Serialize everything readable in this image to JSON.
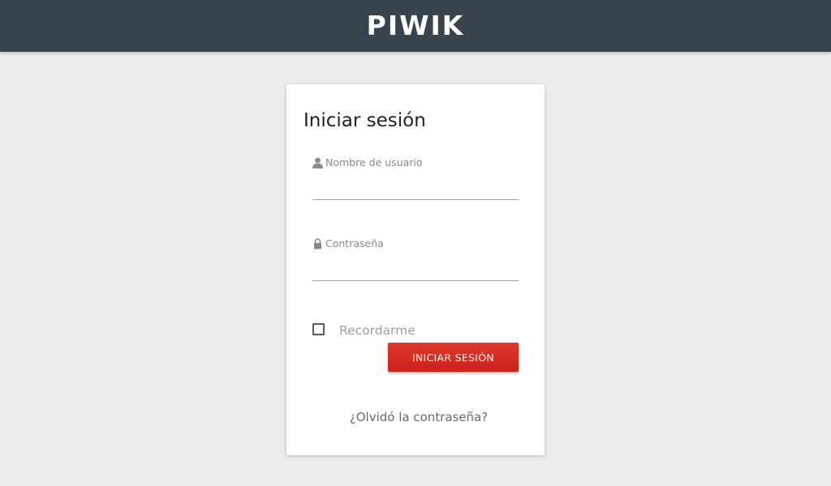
{
  "header": {
    "logo_text": "PIWIK",
    "background_color": "#37444d"
  },
  "login": {
    "title": "Iniciar sesión",
    "username": {
      "label": "Nombre de usuario",
      "icon": "user-icon",
      "value": ""
    },
    "password": {
      "label": "Contraseña",
      "icon": "lock-icon",
      "value": ""
    },
    "remember_label": "Recordarme",
    "remember_checked": false,
    "submit_label": "INICIAR SESIÓN",
    "submit_color": "#d4291f",
    "forgot_label": "¿Olvidó la contraseña?"
  }
}
